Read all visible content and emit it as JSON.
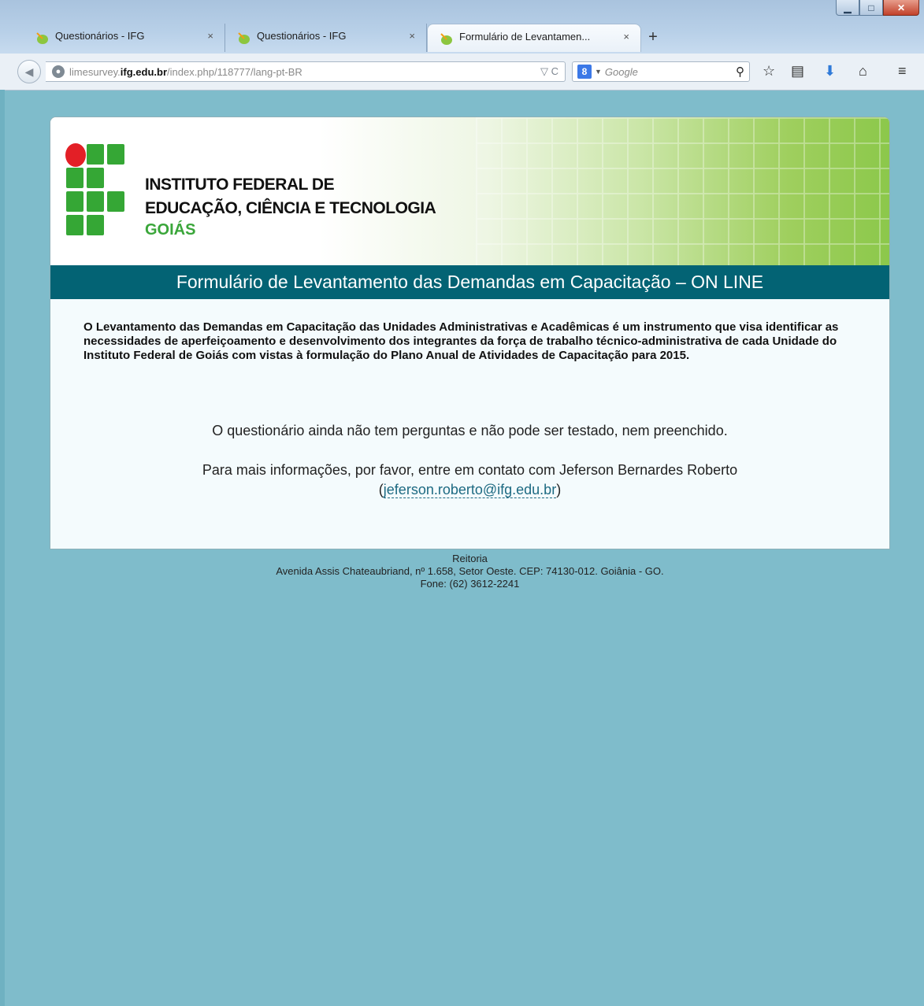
{
  "browser": {
    "tabs": [
      {
        "label": "Questionários - IFG",
        "active": false
      },
      {
        "label": "Questionários - IFG",
        "active": false
      },
      {
        "label": "Formulário de Levantamen...",
        "active": true
      }
    ],
    "close_glyph": "×",
    "new_tab_glyph": "+",
    "url_prefix": "limesurvey.",
    "url_host": "ifg.edu.br",
    "url_path": "/index.php/118777/lang-pt-BR",
    "search_placeholder": "Google",
    "search_engine_badge": "8"
  },
  "page": {
    "institution": {
      "line1": "INSTITUTO FEDERAL DE",
      "line2": "EDUCAÇÃO, CIÊNCIA E TECNOLOGIA",
      "line3": "GOIÁS"
    },
    "title": "Formulário de Levantamento das Demandas em Capacitação – ON LINE",
    "intro": "O Levantamento das Demandas em Capacitação das Unidades Administrativas e Acadêmicas é um instrumento que visa identificar as necessidades de aperfeiçoamento e desenvolvimento dos integrantes da força de trabalho técnico-administrativa de cada Unidade do Instituto Federal de Goiás com vistas à formulação do Plano Anual de Atividades de Capacitação para 2015.",
    "message": "O questionário ainda não tem perguntas e não pode ser testado, nem preenchido.",
    "contact_text": "Para mais informações, por favor, entre em contato com Jeferson Bernardes Roberto",
    "contact_email": "jeferson.roberto@ifg.edu.br",
    "footer": {
      "line1": "Reitoria",
      "line2": "Avenida Assis Chateaubriand, nº 1.658, Setor Oeste. CEP: 74130-012. Goiânia - GO.",
      "line3": "Fone: (62) 3612-2241"
    }
  },
  "colors": {
    "page_background": "#7fbccb",
    "title_bar": "#036374",
    "brand_green": "#35a735",
    "brand_red": "#e31f26",
    "link": "#1d6a82"
  }
}
